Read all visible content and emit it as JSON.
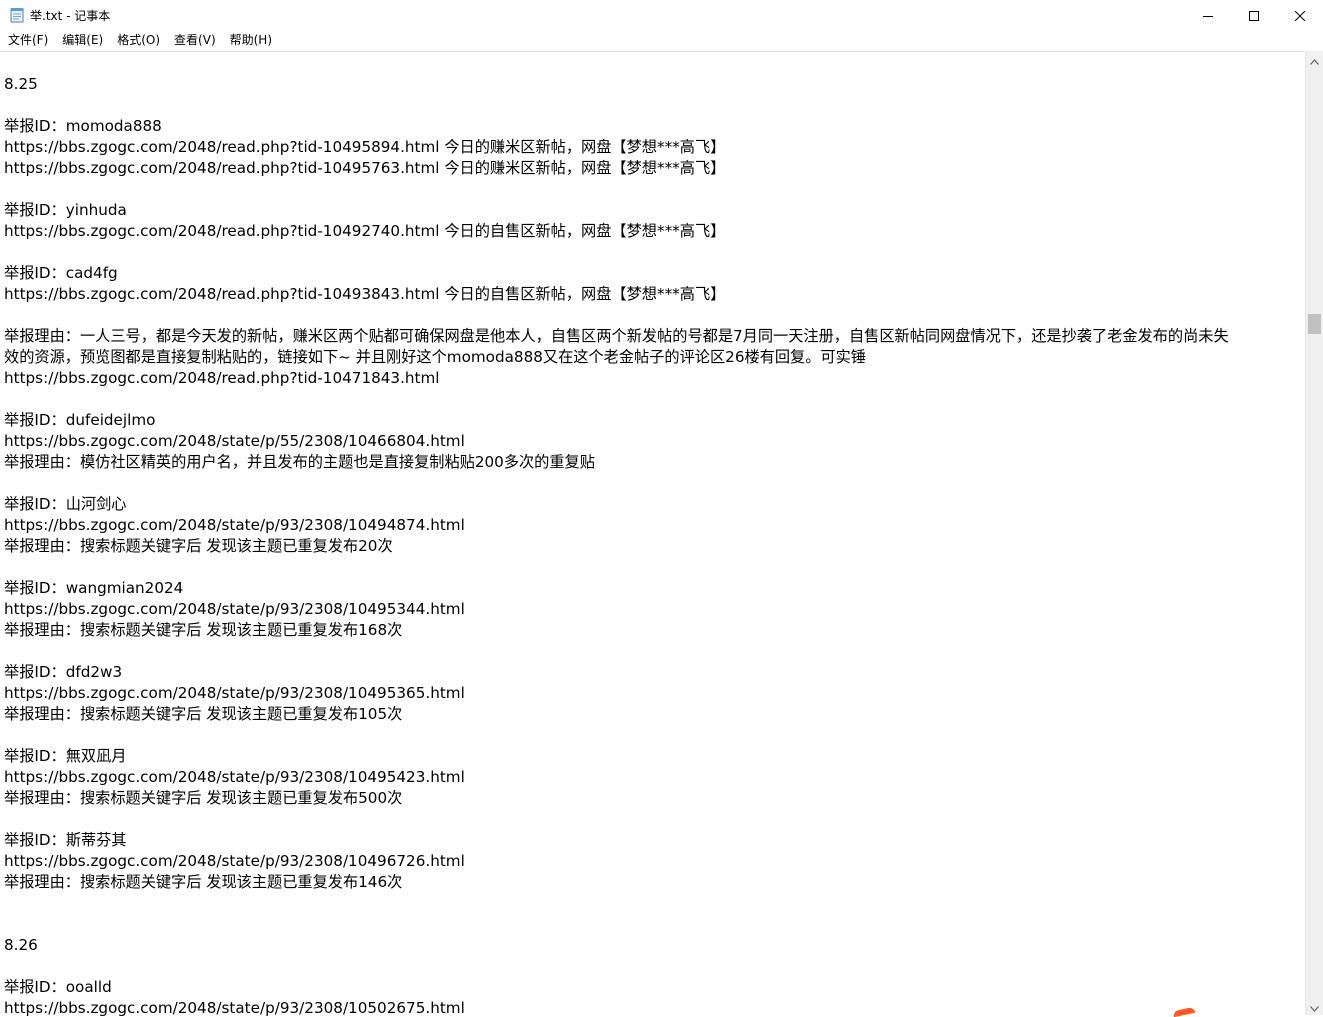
{
  "window": {
    "title": "举.txt - 记事本",
    "icons": {
      "app": "notepad-icon",
      "minimize": "minimize-icon",
      "maximize": "maximize-icon",
      "close": "close-icon"
    }
  },
  "menu": {
    "file": "文件(F)",
    "edit": "编辑(E)",
    "format": "格式(O)",
    "view": "查看(V)",
    "help": "帮助(H)"
  },
  "document": {
    "lines": [
      "8.25",
      "",
      "举报ID：momoda888",
      "https://bbs.zgogc.com/2048/read.php?tid-10495894.html 今日的赚米区新帖，网盘【梦想***高飞】",
      "https://bbs.zgogc.com/2048/read.php?tid-10495763.html 今日的赚米区新帖，网盘【梦想***高飞】",
      "",
      "举报ID：yinhuda",
      "https://bbs.zgogc.com/2048/read.php?tid-10492740.html 今日的自售区新帖，网盘【梦想***高飞】",
      "",
      "举报ID：cad4fg",
      "https://bbs.zgogc.com/2048/read.php?tid-10493843.html 今日的自售区新帖，网盘【梦想***高飞】",
      "",
      "举报理由：一人三号，都是今天发的新帖，赚米区两个贴都可确保网盘是他本人，自售区两个新发帖的号都是7月同一天注册，自售区新帖同网盘情况下，还是抄袭了老金发布的尚未失",
      "效的资源，预览图都是直接复制粘贴的，链接如下~ 并且刚好这个momoda888又在这个老金帖子的评论区26楼有回复。可实锤",
      "https://bbs.zgogc.com/2048/read.php?tid-10471843.html",
      "",
      "举报ID：dufeidejlmo",
      "https://bbs.zgogc.com/2048/state/p/55/2308/10466804.html",
      "举报理由：模仿社区精英的用户名，并且发布的主题也是直接复制粘贴200多次的重复贴",
      "",
      "举报ID：山河剑心",
      "https://bbs.zgogc.com/2048/state/p/93/2308/10494874.html",
      "举报理由：搜索标题关键字后 发现该主题已重复发布20次",
      "",
      "举报ID：wangmian2024",
      "https://bbs.zgogc.com/2048/state/p/93/2308/10495344.html",
      "举报理由：搜索标题关键字后 发现该主题已重复发布168次",
      "",
      "举报ID：dfd2w3",
      "https://bbs.zgogc.com/2048/state/p/93/2308/10495365.html",
      "举报理由：搜索标题关键字后 发现该主题已重复发布105次",
      "",
      "举报ID：無双凪月",
      "https://bbs.zgogc.com/2048/state/p/93/2308/10495423.html",
      "举报理由：搜索标题关键字后 发现该主题已重复发布500次",
      "",
      "举报ID：斯蒂芬其",
      "https://bbs.zgogc.com/2048/state/p/93/2308/10496726.html",
      "举报理由：搜索标题关键字后 发现该主题已重复发布146次",
      "",
      "",
      "8.26",
      "",
      "举报ID：ooalld",
      "https://bbs.zgogc.com/2048/state/p/93/2308/10502675.html"
    ]
  },
  "scrollbar": {
    "position_fraction": 0.27
  }
}
